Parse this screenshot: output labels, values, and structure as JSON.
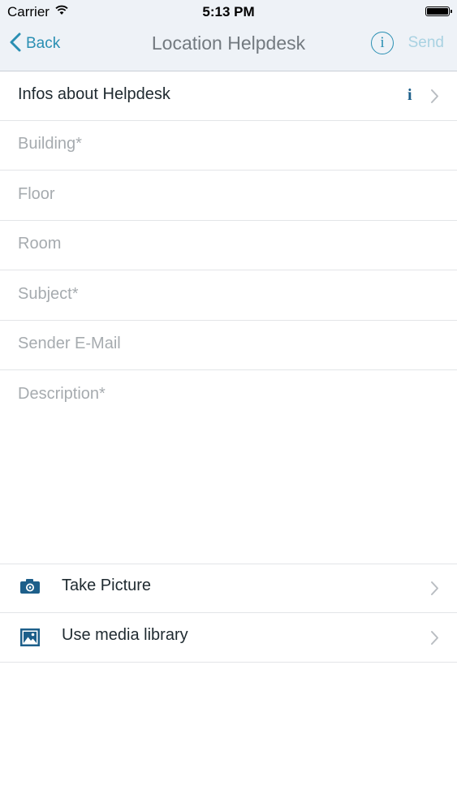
{
  "status_bar": {
    "carrier": "Carrier",
    "time": "5:13 PM"
  },
  "nav": {
    "back_label": "Back",
    "title": "Location Helpdesk",
    "info_glyph": "i",
    "send_label": "Send"
  },
  "info_row": {
    "label": "Infos about Helpdesk",
    "info_glyph": "i"
  },
  "fields": [
    {
      "placeholder": "Building*"
    },
    {
      "placeholder": "Floor"
    },
    {
      "placeholder": "Room"
    },
    {
      "placeholder": "Subject*"
    },
    {
      "placeholder": "Sender E-Mail"
    },
    {
      "placeholder": "Description*"
    }
  ],
  "media": [
    {
      "label": "Take Picture",
      "icon": "camera-icon"
    },
    {
      "label": "Use media library",
      "icon": "image-icon"
    }
  ],
  "colors": {
    "accent": "#2a8fb3",
    "send_disabled": "#a9d2e2",
    "icon_dark": "#1d5f8a",
    "placeholder": "#a6abaf",
    "bar_background": "#eef2f7"
  }
}
